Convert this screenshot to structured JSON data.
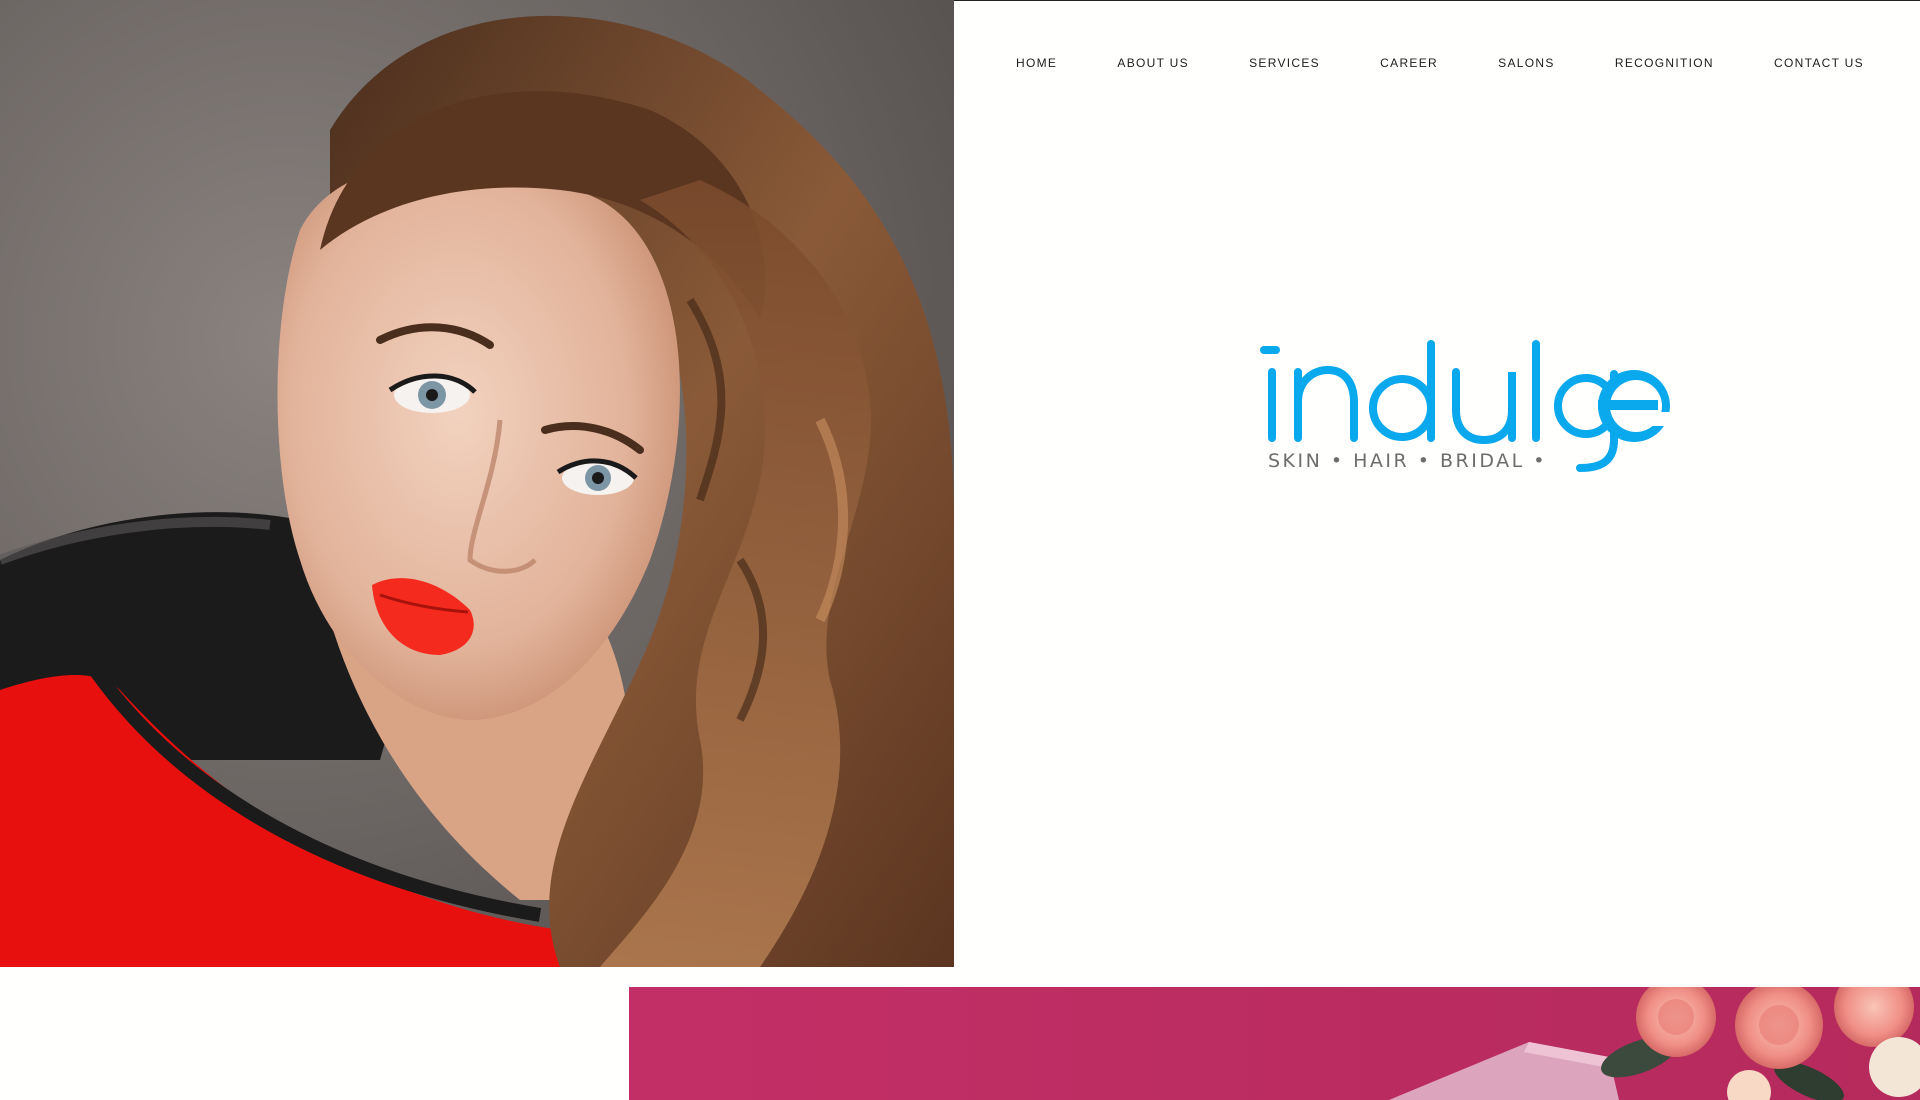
{
  "nav": {
    "items": [
      {
        "label": "HOME"
      },
      {
        "label": "ABOUT US"
      },
      {
        "label": "SERVICES"
      },
      {
        "label": "CAREER"
      },
      {
        "label": "SALONS"
      },
      {
        "label": "RECOGNITION"
      },
      {
        "label": "CONTACT US"
      }
    ]
  },
  "brand": {
    "name": "indulge",
    "tagline": "SKIN • HAIR • BRIDAL •"
  },
  "colors": {
    "brand_blue": "#0aa8ec",
    "tagline_gray": "#6d6d6d",
    "promo_pink": "#bf2d63",
    "nav_text": "#1d1d1d",
    "page_bg": "#fffffd"
  }
}
